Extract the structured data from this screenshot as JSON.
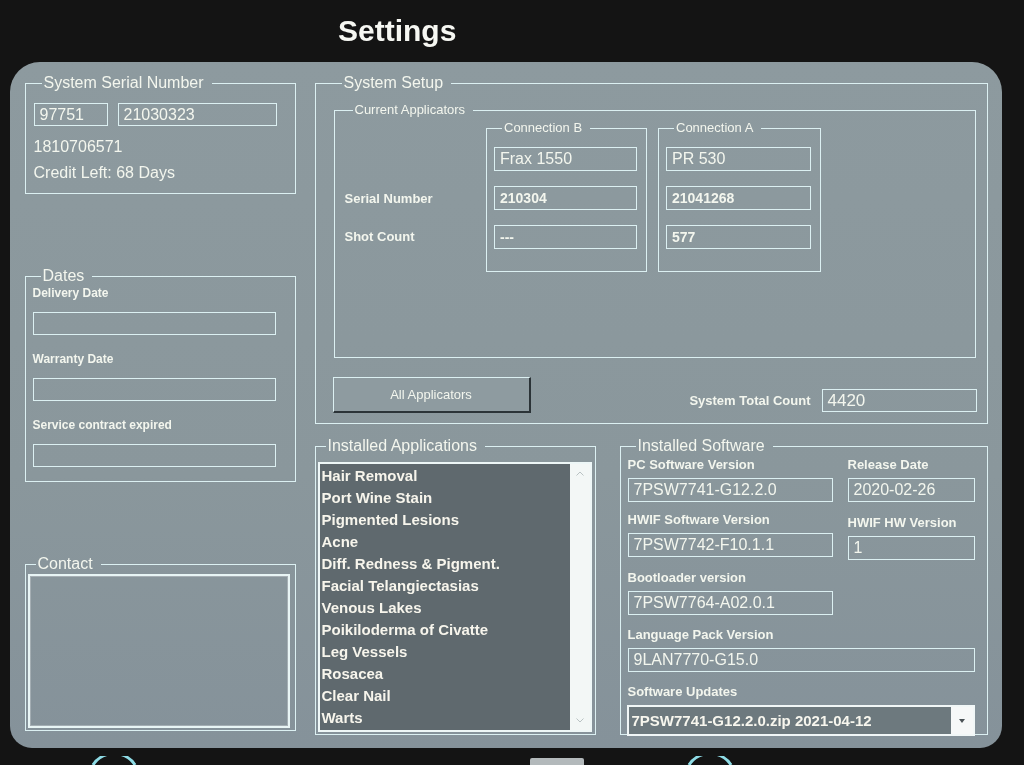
{
  "title": "Settings",
  "system_serial_number": {
    "title": "System Serial Number",
    "fields": [
      "97751",
      "21030323"
    ],
    "lines": [
      "1810706571",
      "Credit Left: 68 Days"
    ]
  },
  "dates": {
    "title": "Dates",
    "fields": [
      {
        "label": "Delivery Date"
      },
      {
        "label": "Warranty Date"
      },
      {
        "label": "Service contract expired"
      }
    ]
  },
  "contact": {
    "title": "Contact"
  },
  "system_setup": {
    "title": "System Setup",
    "current_applicators": {
      "title": "Current Applicators",
      "row_labels": [
        "Serial Number",
        "Shot Count"
      ],
      "connections": [
        {
          "title": "Connection B",
          "name": "Frax 1550",
          "serial_number": "210304",
          "shot_count": "---"
        },
        {
          "title": "Connection A",
          "name": "PR 530",
          "serial_number": "21041268",
          "shot_count": "577"
        }
      ]
    },
    "all_applicators_button": "All Applicators",
    "system_total_count": {
      "label": "System Total Count",
      "value": "4420"
    }
  },
  "installed_applications": {
    "title": "Installed Applications",
    "items": [
      "Hair Removal",
      "Port Wine Stain",
      "Pigmented Lesions",
      "Acne",
      "Diff. Redness & Pigment.",
      "Facial Telangiectasias",
      "Venous Lakes",
      "Poikiloderma of Civatte",
      "Leg Vessels",
      "Rosacea",
      "Clear Nail",
      "Warts"
    ]
  },
  "installed_software": {
    "title": "Installed Software",
    "pc_software_version": {
      "label": "PC Software Version",
      "value": "7PSW7741-G12.2.0"
    },
    "release_date": {
      "label": "Release Date",
      "value": "2020-02-26"
    },
    "hwif_software_version": {
      "label": "HWIF Software Version",
      "value": "7PSW7742-F10.1.1"
    },
    "hwif_hw_version": {
      "label": "HWIF HW Version",
      "value": "1"
    },
    "bootloader_version": {
      "label": "Bootloader version",
      "value": "7PSW7764-A02.0.1"
    },
    "language_pack_version": {
      "label": "Language Pack Version",
      "value": "9LAN7770-G15.0"
    },
    "software_updates": {
      "label": "Software Updates",
      "value": "7PSW7741-G12.2.0.zip 2021-04-12"
    }
  }
}
